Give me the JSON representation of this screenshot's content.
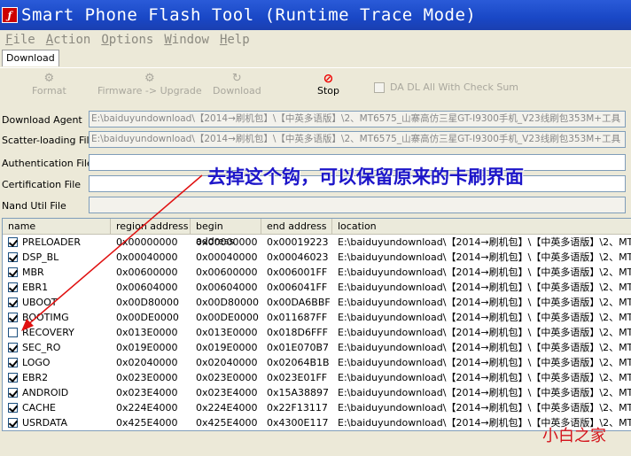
{
  "window": {
    "title": "Smart Phone Flash Tool (Runtime Trace Mode)"
  },
  "menu": [
    {
      "first": "F",
      "rest": "ile"
    },
    {
      "first": "A",
      "rest": "ction"
    },
    {
      "first": "O",
      "rest": "ptions"
    },
    {
      "first": "W",
      "rest": "indow"
    },
    {
      "first": "H",
      "rest": "elp"
    }
  ],
  "tabs": {
    "download": "Download"
  },
  "toolbar": {
    "format": "Format",
    "firmware_upgrade": "Firmware -> Upgrade",
    "download": "Download",
    "stop": "Stop",
    "da_dl_check": "DA DL All With Check Sum"
  },
  "fields": {
    "download_agent": {
      "label": "Download Agent",
      "value": "E:\\baiduyundownload\\【2014→刷机包】\\【中英多语版】\\2、MT6575_山寨高仿三星GT-I9300手机_V23线刷包353M+工具"
    },
    "scatter": {
      "label": "Scatter-loading File",
      "value": "E:\\baiduyundownload\\【2014→刷机包】\\【中英多语版】\\2、MT6575_山寨高仿三星GT-I9300手机_V23线刷包353M+工具"
    },
    "auth": {
      "label": "Authentication File",
      "value": ""
    },
    "cert": {
      "label": "Certification File",
      "value": ""
    },
    "nand": {
      "label": "Nand Util File",
      "value": ""
    }
  },
  "annotation": "去掉这个钩，可以保留原来的卡刷界面",
  "table": {
    "headers": [
      "name",
      "region address",
      "begin address",
      "end address",
      "location"
    ],
    "rows": [
      {
        "checked": true,
        "name": "PRELOADER",
        "region": "0x00000000",
        "begin": "0x00000000",
        "end": "0x00019223",
        "location": "E:\\baiduyundownload\\【2014→刷机包】\\【中英多语版】\\2、MT"
      },
      {
        "checked": true,
        "name": "DSP_BL",
        "region": "0x00040000",
        "begin": "0x00040000",
        "end": "0x00046023",
        "location": "E:\\baiduyundownload\\【2014→刷机包】\\【中英多语版】\\2、MT"
      },
      {
        "checked": true,
        "name": "MBR",
        "region": "0x00600000",
        "begin": "0x00600000",
        "end": "0x006001FF",
        "location": "E:\\baiduyundownload\\【2014→刷机包】\\【中英多语版】\\2、MT"
      },
      {
        "checked": true,
        "name": "EBR1",
        "region": "0x00604000",
        "begin": "0x00604000",
        "end": "0x006041FF",
        "location": "E:\\baiduyundownload\\【2014→刷机包】\\【中英多语版】\\2、MT"
      },
      {
        "checked": true,
        "name": "UBOOT",
        "region": "0x00D80000",
        "begin": "0x00D80000",
        "end": "0x00DA6BBF",
        "location": "E:\\baiduyundownload\\【2014→刷机包】\\【中英多语版】\\2、MT"
      },
      {
        "checked": true,
        "name": "BOOTIMG",
        "region": "0x00DE0000",
        "begin": "0x00DE0000",
        "end": "0x011687FF",
        "location": "E:\\baiduyundownload\\【2014→刷机包】\\【中英多语版】\\2、MT"
      },
      {
        "checked": false,
        "name": "RECOVERY",
        "region": "0x013E0000",
        "begin": "0x013E0000",
        "end": "0x018D6FFF",
        "location": "E:\\baiduyundownload\\【2014→刷机包】\\【中英多语版】\\2、MT"
      },
      {
        "checked": true,
        "name": "SEC_RO",
        "region": "0x019E0000",
        "begin": "0x019E0000",
        "end": "0x01E070B7",
        "location": "E:\\baiduyundownload\\【2014→刷机包】\\【中英多语版】\\2、MT"
      },
      {
        "checked": true,
        "name": "LOGO",
        "region": "0x02040000",
        "begin": "0x02040000",
        "end": "0x02064B1B",
        "location": "E:\\baiduyundownload\\【2014→刷机包】\\【中英多语版】\\2、MT"
      },
      {
        "checked": true,
        "name": "EBR2",
        "region": "0x023E0000",
        "begin": "0x023E0000",
        "end": "0x023E01FF",
        "location": "E:\\baiduyundownload\\【2014→刷机包】\\【中英多语版】\\2、MT"
      },
      {
        "checked": true,
        "name": "ANDROID",
        "region": "0x023E4000",
        "begin": "0x023E4000",
        "end": "0x15A38897",
        "location": "E:\\baiduyundownload\\【2014→刷机包】\\【中英多语版】\\2、MT"
      },
      {
        "checked": true,
        "name": "CACHE",
        "region": "0x224E4000",
        "begin": "0x224E4000",
        "end": "0x22F13117",
        "location": "E:\\baiduyundownload\\【2014→刷机包】\\【中英多语版】\\2、MT"
      },
      {
        "checked": true,
        "name": "USRDATA",
        "region": "0x425E4000",
        "begin": "0x425E4000",
        "end": "0x4300E117",
        "location": "E:\\baiduyundownload\\【2014→刷机包】\\【中英多语版】\\2、MT"
      }
    ]
  },
  "watermark": "小白之家",
  "colors": {
    "title_bg": "#1947c6",
    "annotation": "#1d16c9",
    "arrow": "#e01010",
    "watermark": "#d4121a"
  },
  "icons": {
    "format": "gear-icon",
    "firmware": "gear-icon",
    "download": "refresh-icon",
    "stop": "stop-icon"
  }
}
